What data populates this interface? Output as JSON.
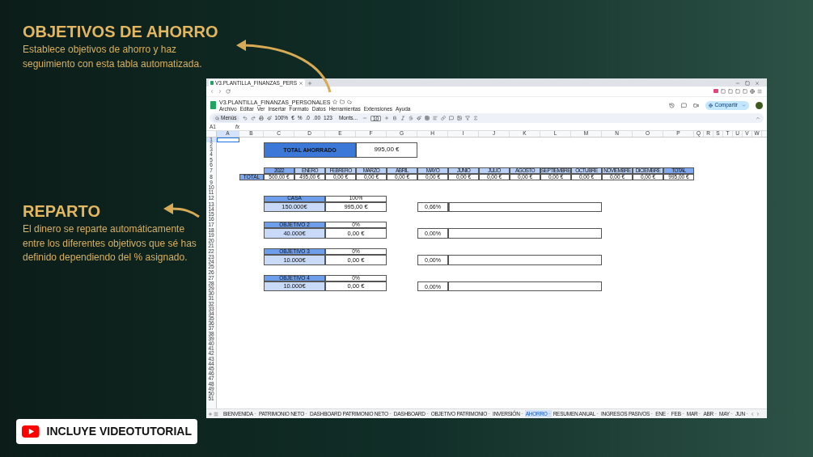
{
  "promo": {
    "sections": [
      {
        "title": "OBJETIVOS DE AHORRO",
        "text": "Establece objetivos de ahorro y haz seguimiento con esta tabla automatizada."
      },
      {
        "title": "REPARTO",
        "text": "El dinero se reparte automáticamente entre los diferentes objetivos que sé has definido dependiendo del % asignado."
      }
    ],
    "badge": "INCLUYE VIDEOTUTORIAL"
  },
  "browser": {
    "tab_title": "V3.PLANTILLA_FINANZAS_PERS"
  },
  "app": {
    "doc_title": "V3.PLANTILLA_FINANZAS_PERSONALES",
    "menus": [
      "Archivo",
      "Editar",
      "Ver",
      "Insertar",
      "Formato",
      "Datos",
      "Herramientas",
      "Extensiones",
      "Ayuda"
    ],
    "toolbar": {
      "search": "Menús",
      "zoom": "100%",
      "currency": "€",
      "percent": "%",
      "decimals_less": ".0",
      "decimals_more": ".00",
      "number_format": "123",
      "font": "Monts...",
      "font_size": "10"
    },
    "share": "Compartir",
    "cell_ref": "A1",
    "fx": "fx"
  },
  "columns": [
    "A",
    "B",
    "C",
    "D",
    "E",
    "F",
    "G",
    "H",
    "I",
    "J",
    "K",
    "L",
    "M",
    "N",
    "O",
    "P",
    "Q",
    "R",
    "S",
    "T",
    "U",
    "V",
    "W"
  ],
  "rows": [
    "1",
    "2",
    "3",
    "4",
    "5",
    "6",
    "7",
    "8",
    "9",
    "10",
    "11",
    "12",
    "13",
    "14",
    "15",
    "16",
    "17",
    "18",
    "19",
    "20",
    "21",
    "22",
    "23",
    "24",
    "25",
    "26",
    "27",
    "28",
    "29",
    "30",
    "31",
    "32",
    "33",
    "34",
    "35",
    "36",
    "37",
    "38",
    "39",
    "40",
    "41",
    "42",
    "43",
    "44",
    "45",
    "46",
    "47",
    "48",
    "49",
    "50",
    "51"
  ],
  "total": {
    "label": "TOTAL AHORRADO",
    "value": "995,00 €"
  },
  "monthly": {
    "row_label": "TOTAL",
    "headers": [
      "2022",
      "ENERO",
      "FEBRERO",
      "MARZO",
      "ABRIL",
      "MAYO",
      "JUNIO",
      "JULIO",
      "AGOSTO",
      "SEPTIEMBRE",
      "OCTUBRE",
      "NOVIEMBRE",
      "DICIEMBRE",
      "TOTAL"
    ],
    "values": [
      "500,00 €",
      "495,00 €",
      "0,00 €",
      "0,00 €",
      "0,00 €",
      "0,00 €",
      "0,00 €",
      "0,00 €",
      "0,00 €",
      "0,00 €",
      "0,00 €",
      "0,00 €",
      "0,00 €",
      "995,00 €"
    ]
  },
  "goals": [
    {
      "name": "CASA",
      "share": "100%",
      "target": "150.000€",
      "amount": "995,00 €",
      "progress": "0,66%",
      "level": 0.0066
    },
    {
      "name": "OBJETIVO 2",
      "share": "0%",
      "target": "40.000€",
      "amount": "0,00 €",
      "progress": "0,00%",
      "level": 0
    },
    {
      "name": "OBJETIVO 3",
      "share": "0%",
      "target": "10.000€",
      "amount": "0,00 €",
      "progress": "0,00%",
      "level": 0
    },
    {
      "name": "OBJETIVO 4",
      "share": "0%",
      "target": "10.000€",
      "amount": "0,00 €",
      "progress": "0,00%",
      "level": 0
    }
  ],
  "sheet_tabs": [
    {
      "label": "BIENVENIDA",
      "selected": false
    },
    {
      "label": "PATRIMONIO NETO",
      "selected": false
    },
    {
      "label": "DASHBOARD PATRIMONIO NETO",
      "selected": false
    },
    {
      "label": "DASHBOARD",
      "selected": false
    },
    {
      "label": "OBJETIVO PATRIMONIO",
      "selected": false
    },
    {
      "label": "INVERSIÓN",
      "selected": false
    },
    {
      "label": "AHORRO",
      "selected": true
    },
    {
      "label": "RESUMEN ANUAL",
      "selected": false
    },
    {
      "label": "INGRESOS PASIVOS",
      "selected": false
    },
    {
      "label": "ENE",
      "selected": false
    },
    {
      "label": "FEB",
      "selected": false
    },
    {
      "label": "MAR",
      "selected": false
    },
    {
      "label": "ABR",
      "selected": false
    },
    {
      "label": "MAY",
      "selected": false
    },
    {
      "label": "JUN",
      "selected": false
    }
  ]
}
